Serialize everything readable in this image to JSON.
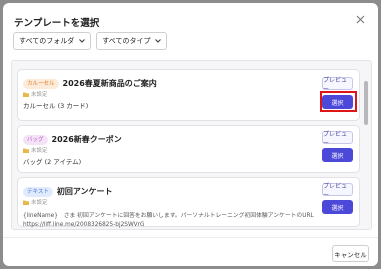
{
  "dialog": {
    "title": "テンプレートを選択",
    "close_icon": "close-icon"
  },
  "filters": {
    "folder_select": "すべてのフォルダ",
    "type_select": "すべてのタイプ"
  },
  "templates": [
    {
      "badge": "カルーセル",
      "title": "2026春夏新商品のご案内",
      "folder": "未設定",
      "description": "カルーセル (3 カード)",
      "preview_label": "プレビュー",
      "select_label": "選択"
    },
    {
      "badge": "バッグ",
      "title": "2026新春クーポン",
      "folder": "未設定",
      "description": "バッグ (2 アイテム)",
      "preview_label": "プレビュー",
      "select_label": "選択"
    },
    {
      "badge": "テキスト",
      "title": "初回アンケート",
      "folder": "未設定",
      "description_line1": "{lineName}　さま 初回アンケートに回答をお願いします。パーソナルトレーニング初回体験アンケートのURL",
      "description_line2": "https://liff.line.me/2008326825-bj2SWVrG",
      "preview_label": "プレビュー",
      "select_label": "選択"
    }
  ],
  "footer": {
    "cancel_label": "キャンセル"
  },
  "colors": {
    "primary": "#4d49d8",
    "highlight": "#e01515"
  }
}
